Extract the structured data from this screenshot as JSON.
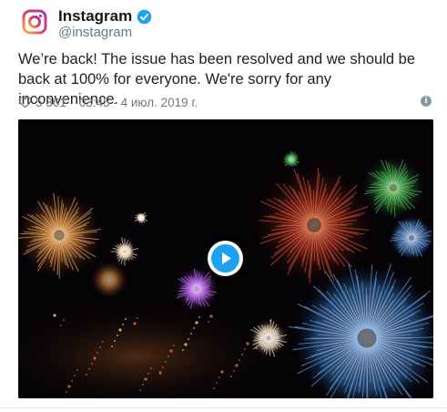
{
  "tweet": {
    "author_name": "Instagram",
    "author_handle": "@instagram",
    "verified": true,
    "text": "We’re back! The issue has been resolved and we should be\nback at 100% for everyone. We're sorry for any inconvenience.",
    "likes": "5 361",
    "timestamp": "03:45 - 4 июл. 2019 г.",
    "info_glyph": "i"
  },
  "media": {
    "type": "video",
    "description_icon": "play-icon"
  },
  "colors": {
    "verified": "#1da1f2",
    "play_button": "#1da1f2",
    "meta_text": "#697882",
    "handle": "#657786"
  }
}
